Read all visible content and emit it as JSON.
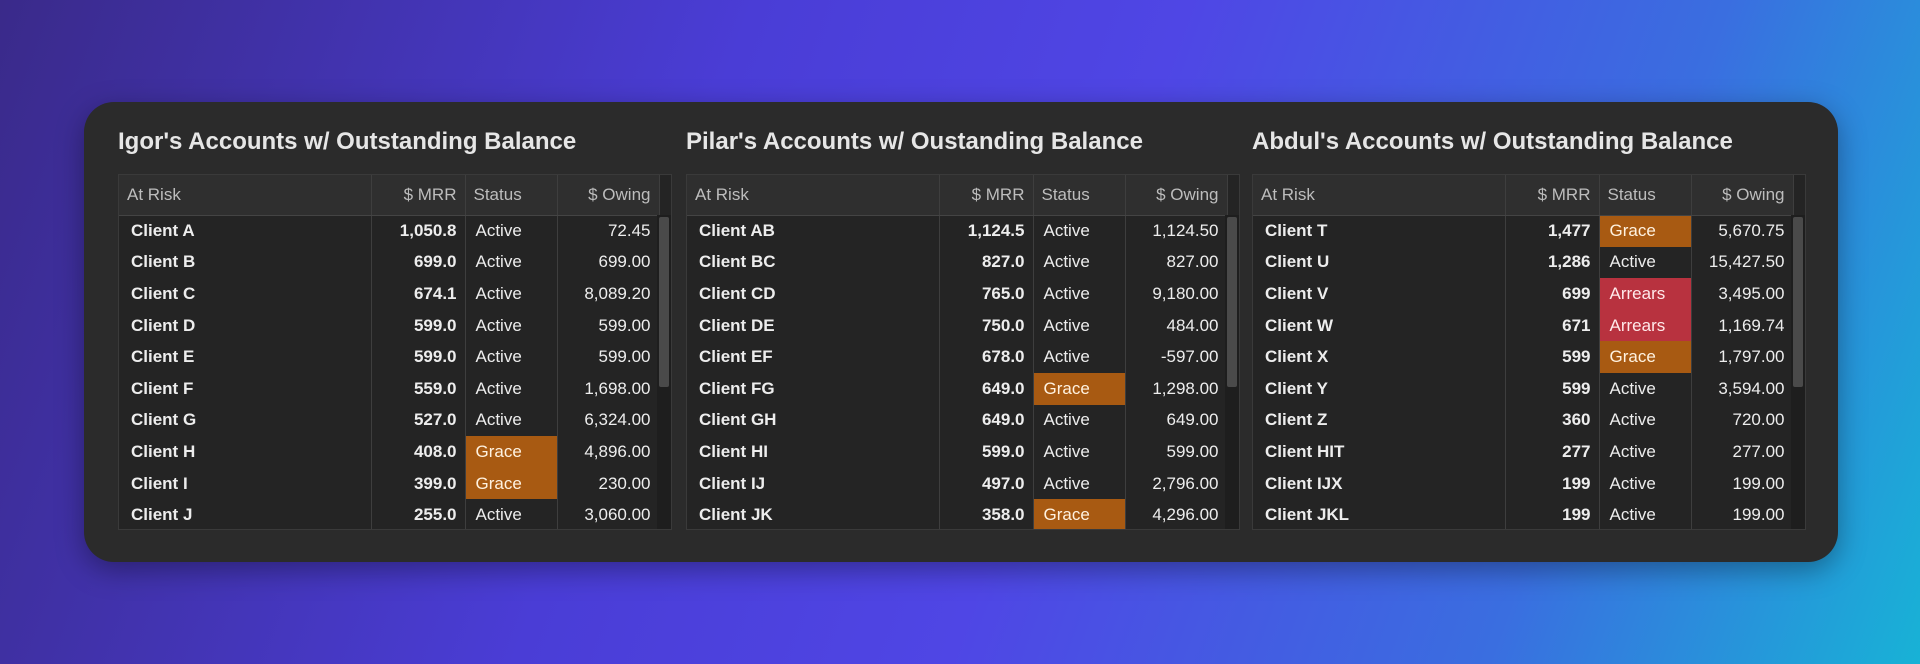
{
  "columns": {
    "risk": "At Risk",
    "mrr": "$ MRR",
    "status": "Status",
    "owing": "$ Owing"
  },
  "colors": {
    "grace": "#a85a12",
    "arrears": "#b8323f"
  },
  "panels": [
    {
      "title": "Igor's Accounts w/ Outstanding Balance",
      "rows": [
        {
          "client": "Client A",
          "mrr": "1,050.8",
          "status": "Active",
          "owing": "72.45"
        },
        {
          "client": "Client B",
          "mrr": "699.0",
          "status": "Active",
          "owing": "699.00"
        },
        {
          "client": "Client C",
          "mrr": "674.1",
          "status": "Active",
          "owing": "8,089.20"
        },
        {
          "client": "Client D",
          "mrr": "599.0",
          "status": "Active",
          "owing": "599.00"
        },
        {
          "client": "Client E",
          "mrr": "599.0",
          "status": "Active",
          "owing": "599.00"
        },
        {
          "client": "Client F",
          "mrr": "559.0",
          "status": "Active",
          "owing": "1,698.00"
        },
        {
          "client": "Client G",
          "mrr": "527.0",
          "status": "Active",
          "owing": "6,324.00"
        },
        {
          "client": "Client H",
          "mrr": "408.0",
          "status": "Grace",
          "owing": "4,896.00"
        },
        {
          "client": "Client I",
          "mrr": "399.0",
          "status": "Grace",
          "owing": "230.00"
        },
        {
          "client": "Client J",
          "mrr": "255.0",
          "status": "Active",
          "owing": "3,060.00"
        }
      ]
    },
    {
      "title": "Pilar's Accounts w/ Oustanding Balance",
      "rows": [
        {
          "client": "Client AB",
          "mrr": "1,124.5",
          "status": "Active",
          "owing": "1,124.50"
        },
        {
          "client": "Client BC",
          "mrr": "827.0",
          "status": "Active",
          "owing": "827.00"
        },
        {
          "client": "Client CD",
          "mrr": "765.0",
          "status": "Active",
          "owing": "9,180.00"
        },
        {
          "client": "Client DE",
          "mrr": "750.0",
          "status": "Active",
          "owing": "484.00"
        },
        {
          "client": "Client EF",
          "mrr": "678.0",
          "status": "Active",
          "owing": "-597.00"
        },
        {
          "client": "Client FG",
          "mrr": "649.0",
          "status": "Grace",
          "owing": "1,298.00"
        },
        {
          "client": "Client GH",
          "mrr": "649.0",
          "status": "Active",
          "owing": "649.00"
        },
        {
          "client": "Client HI",
          "mrr": "599.0",
          "status": "Active",
          "owing": "599.00"
        },
        {
          "client": "Client IJ",
          "mrr": "497.0",
          "status": "Active",
          "owing": "2,796.00"
        },
        {
          "client": "Client JK",
          "mrr": "358.0",
          "status": "Grace",
          "owing": "4,296.00"
        }
      ]
    },
    {
      "title": "Abdul's Accounts w/ Outstanding Balance",
      "rows": [
        {
          "client": "Client T",
          "mrr": "1,477",
          "status": "Grace",
          "owing": "5,670.75"
        },
        {
          "client": "Client U",
          "mrr": "1,286",
          "status": "Active",
          "owing": "15,427.50"
        },
        {
          "client": "Client V",
          "mrr": "699",
          "status": "Arrears",
          "owing": "3,495.00"
        },
        {
          "client": "Client W",
          "mrr": "671",
          "status": "Arrears",
          "owing": "1,169.74"
        },
        {
          "client": "Client X",
          "mrr": "599",
          "status": "Grace",
          "owing": "1,797.00"
        },
        {
          "client": "Client Y",
          "mrr": "599",
          "status": "Active",
          "owing": "3,594.00"
        },
        {
          "client": "Client Z",
          "mrr": "360",
          "status": "Active",
          "owing": "720.00"
        },
        {
          "client": "Client HIT",
          "mrr": "277",
          "status": "Active",
          "owing": "277.00"
        },
        {
          "client": "Client IJX",
          "mrr": "199",
          "status": "Active",
          "owing": "199.00"
        },
        {
          "client": "Client JKL",
          "mrr": "199",
          "status": "Active",
          "owing": "199.00"
        }
      ]
    }
  ]
}
